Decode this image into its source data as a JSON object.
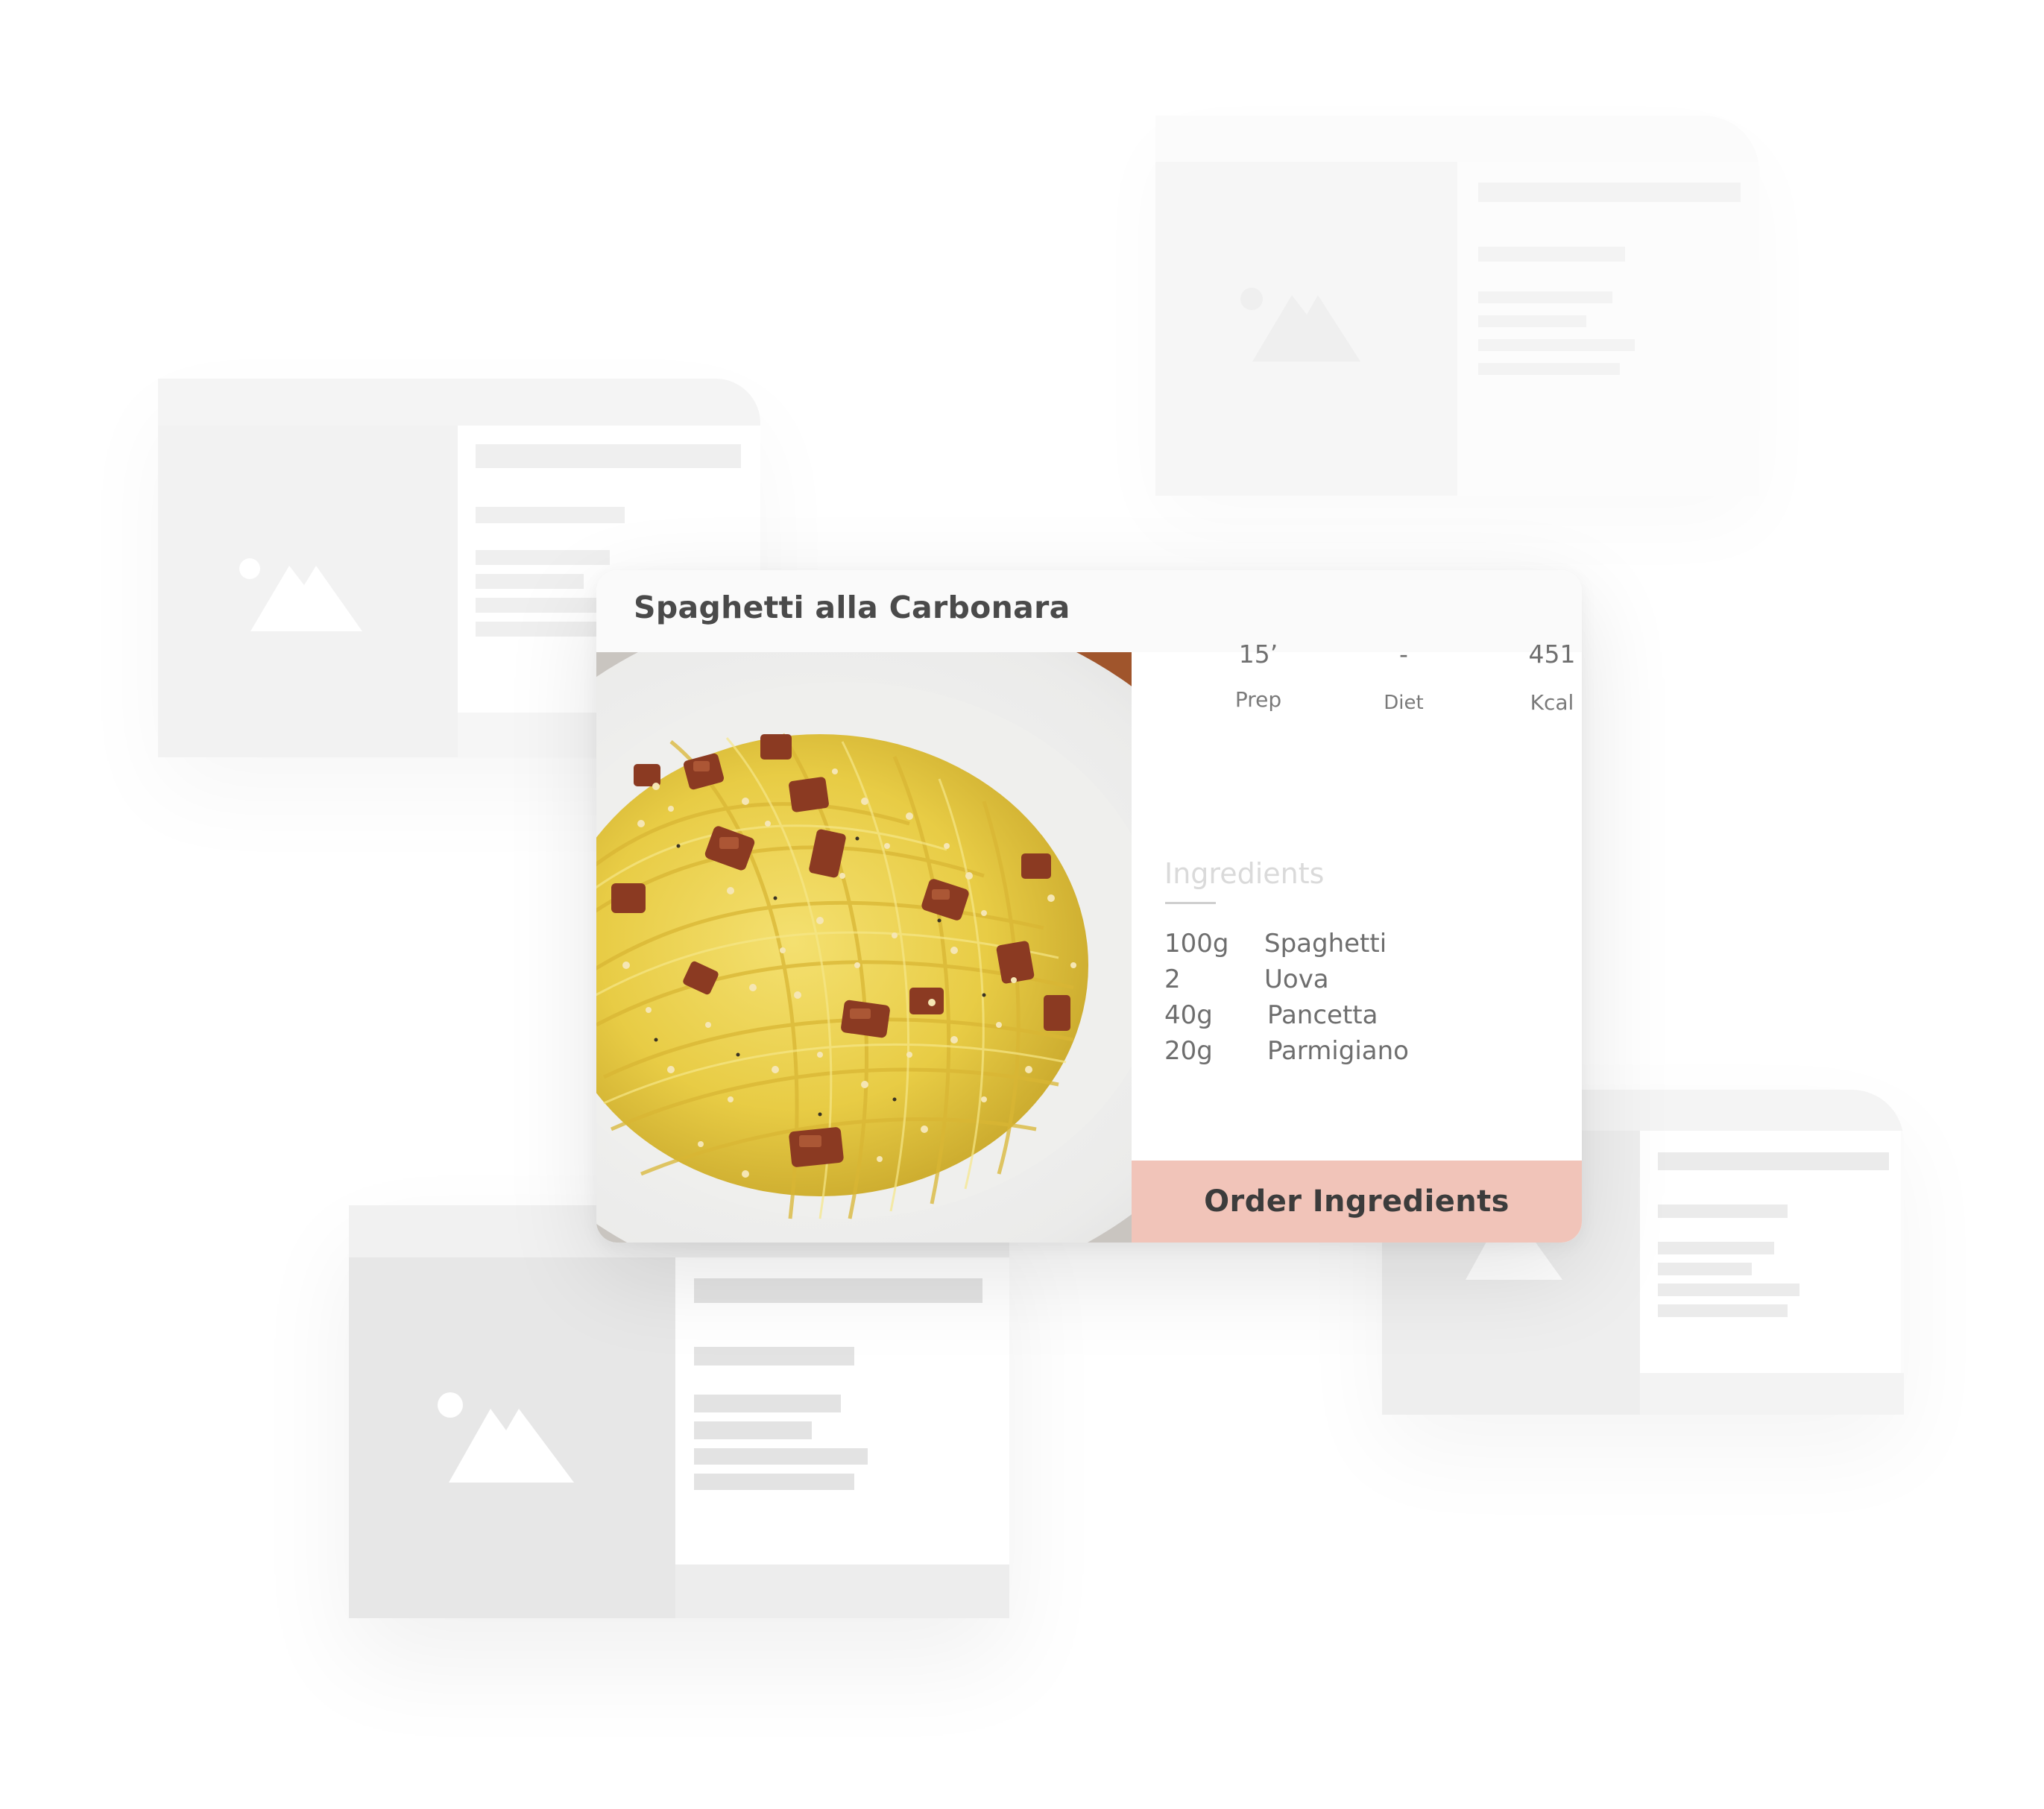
{
  "recipe": {
    "title": "Spaghetti alla Carbonara",
    "photo": "spaghetti-carbonara-photo",
    "stats": [
      {
        "value": "15’",
        "label": "Prep"
      },
      {
        "value": "-",
        "label": "Diet"
      },
      {
        "value": "451",
        "label": "Kcal"
      }
    ],
    "ingredients_heading": "Ingredients",
    "ingredients": [
      {
        "qty": "100g",
        "name": "Spaghetti"
      },
      {
        "qty": "2",
        "name": "Uova"
      },
      {
        "qty": "40g",
        "name": "Pancetta"
      },
      {
        "qty": "20g",
        "name": "Parmigiano"
      }
    ],
    "order_label": "Order Ingredients"
  },
  "colors": {
    "accent": "#f1c4b9",
    "title_text": "#4a4a4a",
    "placeholder_gray": "#e7e7e7"
  },
  "icons": {
    "placeholder": "image-placeholder-icon"
  }
}
